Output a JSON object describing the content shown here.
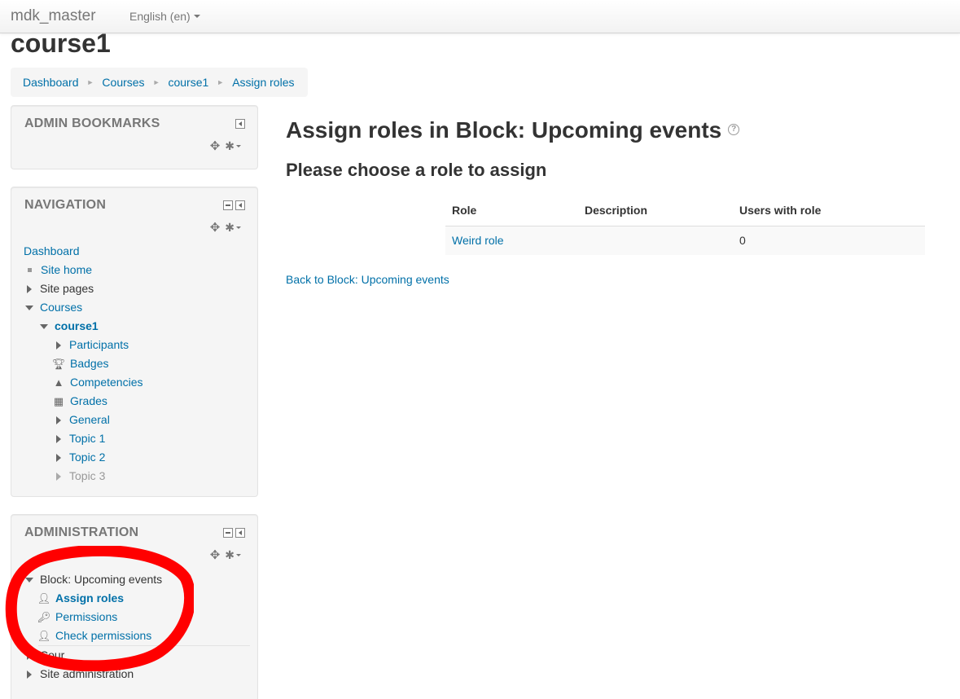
{
  "navbar": {
    "brand": "mdk_master",
    "language": "English ‎(en)‎"
  },
  "page": {
    "course_title": "course1",
    "breadcrumb": [
      "Dashboard",
      "Courses",
      "course1",
      "Assign roles"
    ]
  },
  "blocks": {
    "admin_bookmarks": {
      "title": "ADMIN BOOKMARKS"
    },
    "navigation": {
      "title": "NAVIGATION",
      "dashboard": "Dashboard",
      "site_home": "Site home",
      "site_pages": "Site pages",
      "courses": "Courses",
      "course1": "course1",
      "participants": "Participants",
      "badges": "Badges",
      "competencies": "Competencies",
      "grades": "Grades",
      "general": "General",
      "topic1": "Topic 1",
      "topic2": "Topic 2",
      "topic3": "Topic 3"
    },
    "administration": {
      "title": "ADMINISTRATION",
      "block_upcoming": "Block: Upcoming events",
      "assign_roles": "Assign roles",
      "permissions": "Permissions",
      "check_permissions": "Check permissions",
      "course_admin_partial": "Cour",
      "site_admin": "Site administration"
    }
  },
  "main": {
    "heading": "Assign roles in Block: Upcoming events",
    "subheading": "Please choose a role to assign",
    "table": {
      "headers": [
        "Role",
        "Description",
        "Users with role"
      ],
      "rows": [
        {
          "role": "Weird role",
          "description": "",
          "users": "0"
        }
      ]
    },
    "back_link": "Back to Block: Upcoming events"
  },
  "colors": {
    "link": "#0070a8",
    "annotation": "#ff0000"
  }
}
